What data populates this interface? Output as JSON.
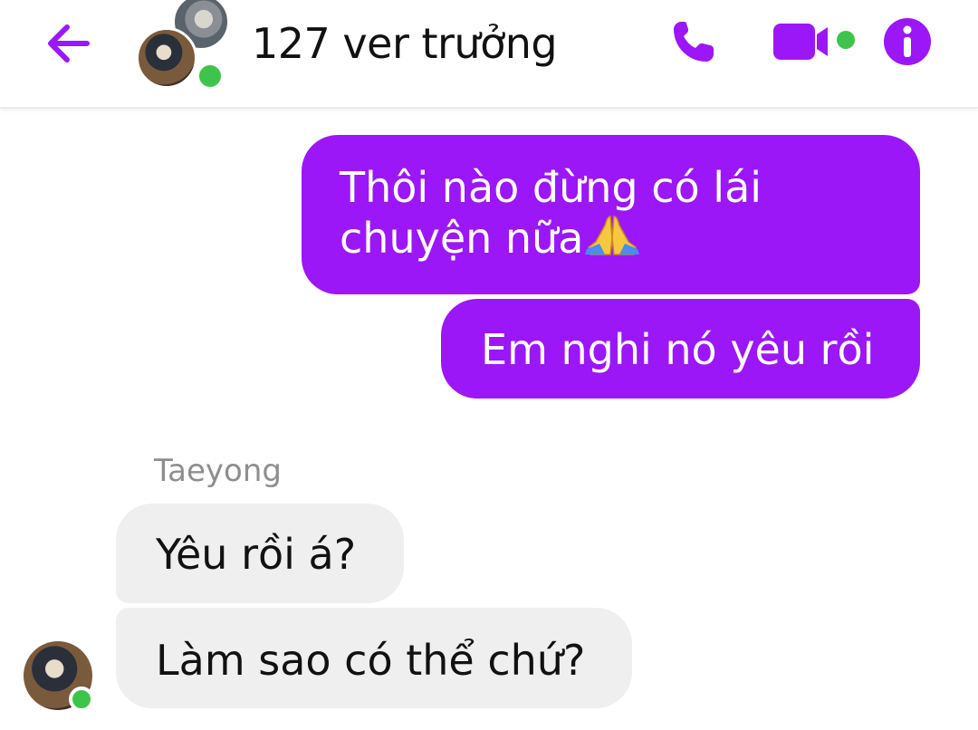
{
  "header": {
    "title": "127 ver trưởng",
    "back_icon": "arrow-left-icon",
    "call_icon": "phone-icon",
    "video_icon": "video-camera-icon",
    "info_icon": "info-icon",
    "accent_color": "#9b17f7",
    "online_color": "#3ec44c"
  },
  "messages": [
    {
      "direction": "out",
      "line1": "Thôi nào đừng có lái",
      "line2": "chuyện nữa",
      "emoji": "folded-hands-emoji"
    },
    {
      "direction": "out",
      "text": "Em nghi nó yêu rồi"
    },
    {
      "direction": "in",
      "sender": "Taeyong",
      "text": "Yêu rồi á?"
    },
    {
      "direction": "in",
      "text": "Làm sao có thể chứ?"
    }
  ]
}
